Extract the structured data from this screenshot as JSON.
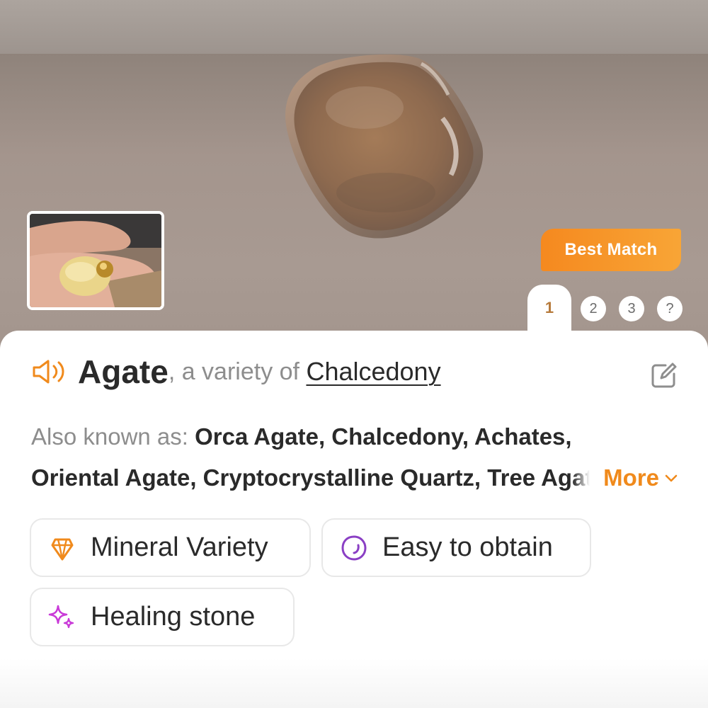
{
  "hero": {
    "best_match_label": "Best Match",
    "pages": [
      "1",
      "2",
      "3",
      "?"
    ],
    "active_page": "1"
  },
  "result": {
    "name": "Agate",
    "separator": ", a variety of ",
    "parent": "Chalcedony"
  },
  "aka": {
    "label": "Also known as: ",
    "line1": "Orca Agate, Chalcedony, Achates,",
    "line2": "Oriental Agate, Cryptocrystalline Quartz, Tree Agate",
    "more_label": "More"
  },
  "tags": [
    {
      "label": "Mineral Variety",
      "icon": "crystal-icon"
    },
    {
      "label": "Easy to obtain",
      "icon": "stone-icon"
    },
    {
      "label": "Healing stone",
      "icon": "sparkle-icon"
    }
  ],
  "colors": {
    "accent_orange": "#f08a1c",
    "active_page_text": "#b77b3c",
    "stone_icon_purple": "#8a3fc4",
    "sparkle_icon_magenta": "#c93ad8"
  }
}
